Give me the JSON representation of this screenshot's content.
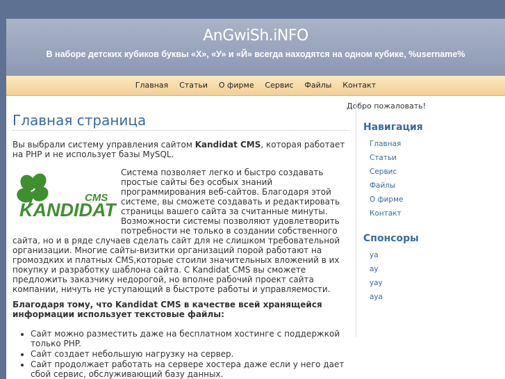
{
  "header": {
    "site_title": "AnGwiSh.iNFO",
    "tagline": "В наборе детских кубиков буквы «Х», «У» и «Й» всегда находятся на одном кубике, %username%"
  },
  "nav": [
    "Главная",
    "Статьи",
    "О фирме",
    "Сервис",
    "Файлы",
    "Контакт"
  ],
  "welcome": "Добро пожаловать!",
  "main": {
    "title": "Главная страница",
    "intro_before": "Вы выбрали систему управления сайтом ",
    "intro_cms": "Kandidat CMS",
    "intro_after": ", которая работает на PHP и не использует базы MySQL.",
    "logo_brand": "KANDIDAT",
    "logo_cms": "CMS",
    "para": "Система позволяет легко и быстро создавать простые сайты без особых знаний программирования веб-сайтов. Благодаря этой системе, вы сможете создавать и редактировать страницы вашего сайта за считанные минуты. Возможности системы позволяют удовлетворить потребности не только в создании собственного сайта, но и в ряде случаев сделать сайт для не слишком требовательной организации. Многие сайты-визитки организаций порой работают на громоздких и платных CMS,которые стоили значительных вложений в их покупку и разработку шаблона сайта. С Kandidat CMS вы сможете предложить заказчику недорогой, но вполне рабочий проект сайта компании, ничуть не уступающий в быстроте работы и управляемости.",
    "bold_line": "Благодаря тому, что Kandidat CMS в качестве всей хранящейся информации использует текстовые файлы:",
    "features": [
      "Сайт можно разместить даже на бесплатном хостинге с поддержкой только PHP.",
      "Сайт создает небольшую нагрузку на сервер.",
      "Сайт продолжает работать на сервере хостера даже если у него дает сбой сервис, обслуживающий базу данных."
    ]
  },
  "sidebar": {
    "nav_title": "Навигация",
    "nav_items": [
      "Главная",
      "Статьи",
      "Сервис",
      "Файлы",
      "О фирме",
      "Контакт"
    ],
    "sponsors_title": "Спонсоры",
    "sponsors": [
      "ya",
      "ay",
      "yay",
      "aya"
    ]
  },
  "colors": {
    "accent": "#3a6a9a",
    "background": "#5f7193",
    "nav": "#f6d9a3"
  }
}
